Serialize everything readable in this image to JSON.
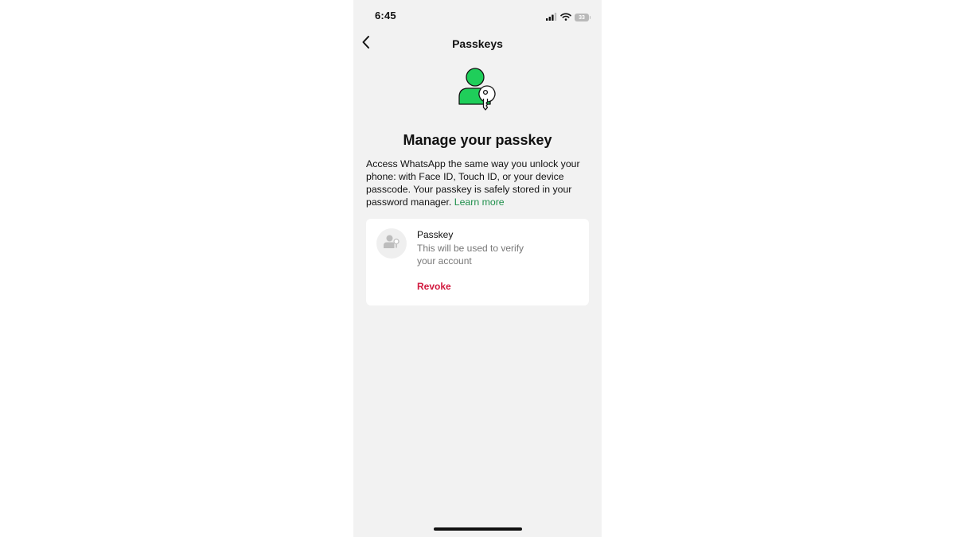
{
  "status_bar": {
    "time": "6:45",
    "battery_level": "33",
    "icons": [
      "signal-icon",
      "wifi-icon",
      "battery-icon"
    ]
  },
  "nav": {
    "back_icon": "chevron-left-icon",
    "title": "Passkeys"
  },
  "hero": {
    "icon": "user-key-icon",
    "accent_color": "#1fce5a"
  },
  "heading": "Manage your passkey",
  "description": {
    "text": "Access WhatsApp the same way you unlock your phone: with Face ID, Touch ID, or your device passcode. Your passkey is safely stored in your password manager.",
    "link_label": "Learn more",
    "link_color": "#1d8f4a"
  },
  "passkey_card": {
    "avatar_icon": "user-key-icon",
    "title": "Passkey",
    "subtitle": "This will be used to verify your account",
    "revoke_label": "Revoke",
    "revoke_color": "#d1193e"
  }
}
